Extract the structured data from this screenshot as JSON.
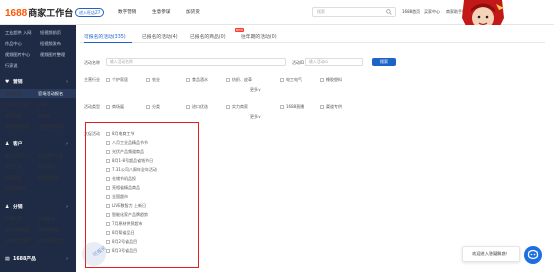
{
  "header": {
    "logo_brand": "1688",
    "logo_rest": "商家工作台",
    "entry_label": "进入旺店Z7",
    "nav": [
      "数字营销",
      "生意参谋",
      "加货货"
    ],
    "search_placeholder": "搜索",
    "right_links": [
      "1688首页",
      "买家中心",
      "商家助手推荐",
      "消息"
    ]
  },
  "sidebar": {
    "items": [
      {
        "label": "工业超供 入网",
        "label2": "短视频前页",
        "y": 28
      },
      {
        "label": "作品中心",
        "label2": "短视频发布",
        "y": 40
      },
      {
        "label": "视频图片中心",
        "label2": "视频图片整理",
        "y": 52
      },
      {
        "label": "行家说",
        "label2": "",
        "y": 64
      }
    ],
    "marketing": {
      "icon": "♥",
      "label": "营销",
      "arrow": "›"
    },
    "marketing_items": [
      {
        "label": "营销首页",
        "label2": "官场活动报名",
        "active": true
      },
      {
        "label": "PLUS会员价",
        "label2": "分销"
      },
      {
        "label": "优惠管理",
        "label2": "新建定"
      },
      {
        "label": "新增营销投放",
        "label2": "主题营销管理"
      }
    ],
    "customer": {
      "icon": "♟",
      "label": "客户",
      "arrow": "›"
    },
    "customer_items": [
      {
        "label": "客户运营中心",
        "label2": "会员客户运营"
      },
      {
        "label": "宣传业务",
        "label2": "会员管理"
      },
      {
        "label": "搭建精选",
        "label2": "收藏夹管理"
      },
      {
        "label": "运营联营客",
        "label2": ""
      }
    ],
    "distribution": {
      "icon": "♟",
      "label": "分销",
      "arrow": "›"
    },
    "distribution_items": [
      {
        "label": "招募大厦",
        "label2": "分销管理"
      },
      {
        "label": "我的分销商品",
        "label2": "分销商管理"
      },
      {
        "label": "分销商品管理",
        "label2": "我的分销商品"
      }
    ],
    "product": {
      "icon": "▤",
      "label": "1688产品",
      "arrow": "›"
    }
  },
  "tabs": [
    {
      "label": "可报名的活动(335)",
      "active": true
    },
    {
      "label": "已报名的活动(4)"
    },
    {
      "label": "已报名的商品(0)"
    },
    {
      "label": "往年期的活动(0)"
    }
  ],
  "filters": {
    "name_label": "活动名称",
    "name_placeholder": "输入活动名称",
    "id_label": "活动ID",
    "id_placeholder": "输入活动ID",
    "search_button": "搜索",
    "industry_label": "主营行业",
    "industries": [
      "个护家居",
      "农业",
      "食品酒水",
      "纺织、皮革",
      "电工电气",
      "橡胶塑料"
    ],
    "industry_more": "更多∨",
    "type_label": "活动类型",
    "types": [
      "商场展",
      "分类",
      "进口优选",
      "实力商家",
      "1688直播",
      "渠道专供"
    ],
    "type_more": "更多∨",
    "scene_label": "大促活动",
    "scenes": [
      "8月电商工节",
      "八月工业品精品节节",
      "光伏产品频道商品",
      "8月1-8号超品省钱节日",
      "7.31公司八周年全年活动",
      "仓储节机品投",
      "亮相省精品商品",
      "全国超市",
      "LIVE数智力 上新日",
      "智能化家产品牌趋势",
      "7月原材供贸超市",
      "8月帮省品日",
      "8月2号省品目",
      "8月3号省品目"
    ]
  },
  "watermark": "可报名",
  "help_popup": "欢迎进入答疑解惑！"
}
